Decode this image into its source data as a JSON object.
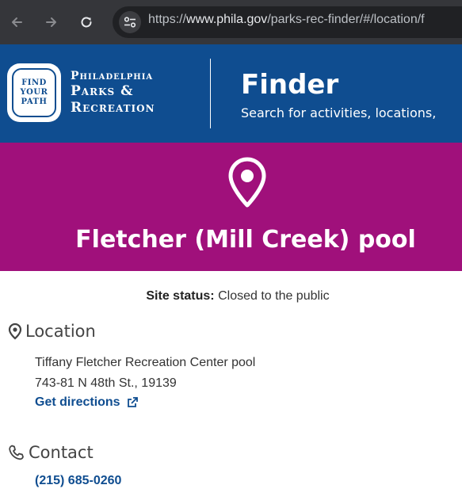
{
  "browser": {
    "back_icon": "arrow-left-icon",
    "forward_icon": "arrow-right-icon",
    "reload_icon": "reload-icon",
    "site_info_icon": "tune-icon",
    "url_prefix": "https://",
    "url_host": "www.phila.gov",
    "url_path": "/parks-rec-finder/#/location/f"
  },
  "header": {
    "seal": [
      "FIND",
      "YOUR",
      "PATH"
    ],
    "org_line1": "Philadelphia",
    "org_line2": "Parks &",
    "org_line3": "Recreation",
    "app_title": "Finder",
    "app_subtitle": "Search for activities, locations,"
  },
  "hero": {
    "icon": "map-pin-icon",
    "title": "Fletcher (Mill Creek) pool"
  },
  "status": {
    "label": "Site status:",
    "value": "Closed to the public"
  },
  "location": {
    "heading": "Location",
    "name": "Tiffany Fletcher Recreation Center pool",
    "address": "743-81 N 48th St., 19139",
    "directions_label": "Get directions"
  },
  "contact": {
    "heading": "Contact",
    "phone": "(215) 685-0260"
  },
  "colors": {
    "header_blue": "#0f4d90",
    "hero_magenta": "#a0107b",
    "link_blue": "#0f4d90"
  }
}
